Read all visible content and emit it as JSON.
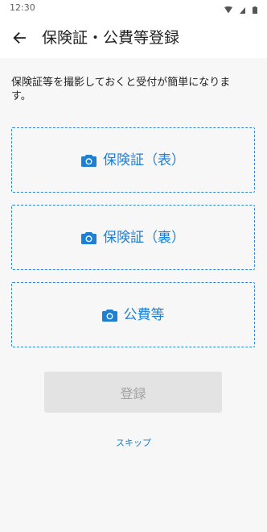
{
  "status_bar": {
    "time": "12:30",
    "icons": [
      "wifi-icon",
      "signal-icon",
      "battery-icon"
    ]
  },
  "app_bar": {
    "title": "保険証・公費等登録",
    "back_icon": "arrow-left-icon"
  },
  "description": "保険証等を撮影しておくと受付が簡単になります。",
  "upload_boxes": [
    {
      "label": "保険証（表）",
      "icon": "camera-icon"
    },
    {
      "label": "保険証（裏）",
      "icon": "camera-icon"
    },
    {
      "label": "公費等",
      "icon": "camera-icon"
    }
  ],
  "submit_button": {
    "label": "登録",
    "enabled": false
  },
  "skip_link": "スキップ",
  "colors": {
    "accent": "#1f7fd0",
    "dashed_border": "#2f86d6",
    "background": "#f7f7f7",
    "disabled_button_bg": "#e3e3e3",
    "disabled_button_text": "#a3a3a3"
  }
}
